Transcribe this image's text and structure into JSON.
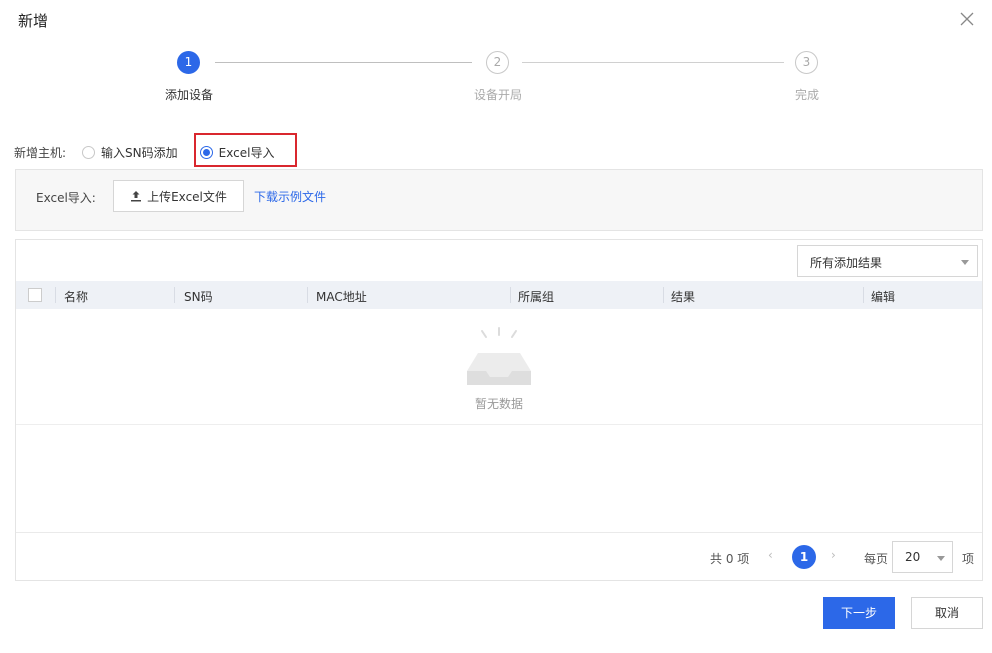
{
  "dialog": {
    "title": "新增"
  },
  "steps": [
    {
      "num": "1",
      "label": "添加设备",
      "state": "active"
    },
    {
      "num": "2",
      "label": "设备开局",
      "state": "idle"
    },
    {
      "num": "3",
      "label": "完成",
      "state": "idle"
    }
  ],
  "host": {
    "label": "新增主机:",
    "options": [
      {
        "label": "输入SN码添加",
        "checked": false
      },
      {
        "label": "Excel导入",
        "checked": true
      }
    ]
  },
  "upload": {
    "label": "Excel导入:",
    "button_label": "上传Excel文件",
    "download_link": "下载示例文件"
  },
  "table": {
    "filter_value": "所有添加结果",
    "columns": [
      "名称",
      "SN码",
      "MAC地址",
      "所属组",
      "结果",
      "编辑"
    ],
    "rows": [],
    "empty_text": "暂无数据"
  },
  "pagination": {
    "total_text": "共 0 项",
    "prev": "‹",
    "current_page": "1",
    "next": "›",
    "per_page_label": "每页",
    "page_size": "20",
    "unit": "项"
  },
  "footer": {
    "next_label": "下一步",
    "cancel_label": "取消"
  },
  "colors": {
    "primary": "#2c68e8",
    "highlight": "#d9272e",
    "header_bg": "#eef1f6"
  },
  "icons": {
    "close": "close-icon",
    "upload": "upload-icon",
    "empty": "empty-inbox-icon"
  }
}
